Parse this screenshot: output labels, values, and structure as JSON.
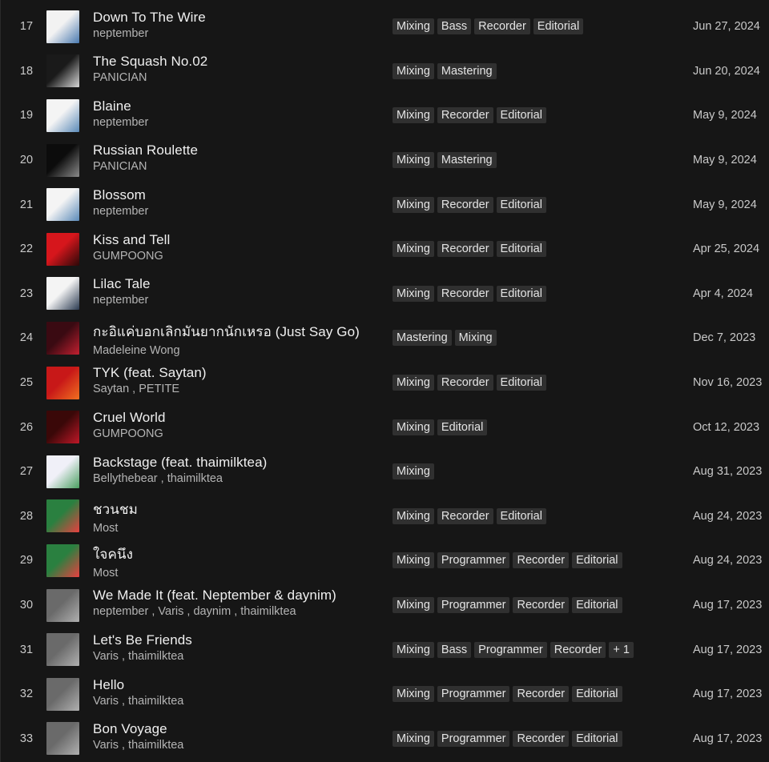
{
  "tracks": [
    {
      "num": "17",
      "title": "Down To The Wire",
      "artist": "neptember",
      "tags": [
        "Mixing",
        "Bass",
        "Recorder",
        "Editorial"
      ],
      "date": "Jun 27, 2024",
      "art_bg": "#f2f2f2",
      "art_fg": "#4a7ab0"
    },
    {
      "num": "18",
      "title": "The Squash No.02",
      "artist": "PANICIAN",
      "tags": [
        "Mixing",
        "Mastering"
      ],
      "date": "Jun 20, 2024",
      "art_bg": "#1a1a1a",
      "art_fg": "#d8d8d8"
    },
    {
      "num": "19",
      "title": "Blaine",
      "artist": "neptember",
      "tags": [
        "Mixing",
        "Recorder",
        "Editorial"
      ],
      "date": "May 9, 2024",
      "art_bg": "#f4f4f4",
      "art_fg": "#5a8ab8"
    },
    {
      "num": "20",
      "title": "Russian Roulette",
      "artist": "PANICIAN",
      "tags": [
        "Mixing",
        "Mastering"
      ],
      "date": "May 9, 2024",
      "art_bg": "#0c0c0c",
      "art_fg": "#8a8a8a"
    },
    {
      "num": "21",
      "title": "Blossom",
      "artist": "neptember",
      "tags": [
        "Mixing",
        "Recorder",
        "Editorial"
      ],
      "date": "May 9, 2024",
      "art_bg": "#f4f4f4",
      "art_fg": "#5a8ab8"
    },
    {
      "num": "22",
      "title": "Kiss and Tell",
      "artist": "GUMPOONG",
      "tags": [
        "Mixing",
        "Recorder",
        "Editorial"
      ],
      "date": "Apr 25, 2024",
      "art_bg": "#d6161c",
      "art_fg": "#2a0808"
    },
    {
      "num": "23",
      "title": "Lilac Tale",
      "artist": "neptember",
      "tags": [
        "Mixing",
        "Recorder",
        "Editorial"
      ],
      "date": "Apr 4, 2024",
      "art_bg": "#f4f4f4",
      "art_fg": "#2a3a50"
    },
    {
      "num": "24",
      "title": "กะอิแค่บอกเลิกมันยากนักเหรอ (Just Say Go)",
      "artist": "Madeleine Wong",
      "tags": [
        "Mastering",
        "Mixing"
      ],
      "date": "Dec 7, 2023",
      "art_bg": "#3a0a12",
      "art_fg": "#c22030"
    },
    {
      "num": "25",
      "title": "TYK (feat. Saytan)",
      "artist": "Saytan , PETITE",
      "tags": [
        "Mixing",
        "Recorder",
        "Editorial"
      ],
      "date": "Nov 16, 2023",
      "art_bg": "#c81818",
      "art_fg": "#f07020"
    },
    {
      "num": "26",
      "title": "Cruel World",
      "artist": "GUMPOONG",
      "tags": [
        "Mixing",
        "Editorial"
      ],
      "date": "Oct 12, 2023",
      "art_bg": "#3a0808",
      "art_fg": "#c01828"
    },
    {
      "num": "27",
      "title": "Backstage (feat. thaimilktea)",
      "artist": "Bellythebear , thaimilktea",
      "tags": [
        "Mixing"
      ],
      "date": "Aug 31, 2023",
      "art_bg": "#f0f0f8",
      "art_fg": "#4aa060"
    },
    {
      "num": "28",
      "title": "ชวนชม",
      "artist": "Most",
      "tags": [
        "Mixing",
        "Recorder",
        "Editorial"
      ],
      "date": "Aug 24, 2023",
      "art_bg": "#2a8040",
      "art_fg": "#e84040"
    },
    {
      "num": "29",
      "title": "ใจคนึง",
      "artist": "Most",
      "tags": [
        "Mixing",
        "Programmer",
        "Recorder",
        "Editorial"
      ],
      "date": "Aug 24, 2023",
      "art_bg": "#2a8040",
      "art_fg": "#e84040"
    },
    {
      "num": "30",
      "title": "We Made It (feat. Neptember & daynim)",
      "artist": "neptember , Varis , daynim , thaimilktea",
      "tags": [
        "Mixing",
        "Programmer",
        "Recorder",
        "Editorial"
      ],
      "date": "Aug 17, 2023",
      "art_bg": "#6a6a6a",
      "art_fg": "#b0b0b0"
    },
    {
      "num": "31",
      "title": "Let's Be Friends",
      "artist": "Varis , thaimilktea",
      "tags": [
        "Mixing",
        "Bass",
        "Programmer",
        "Recorder",
        "+ 1"
      ],
      "date": "Aug 17, 2023",
      "art_bg": "#6a6a6a",
      "art_fg": "#b0b0b0"
    },
    {
      "num": "32",
      "title": "Hello",
      "artist": "Varis , thaimilktea",
      "tags": [
        "Mixing",
        "Programmer",
        "Recorder",
        "Editorial"
      ],
      "date": "Aug 17, 2023",
      "art_bg": "#6a6a6a",
      "art_fg": "#b0b0b0"
    },
    {
      "num": "33",
      "title": "Bon Voyage",
      "artist": "Varis , thaimilktea",
      "tags": [
        "Mixing",
        "Programmer",
        "Recorder",
        "Editorial"
      ],
      "date": "Aug 17, 2023",
      "art_bg": "#6a6a6a",
      "art_fg": "#b0b0b0"
    }
  ]
}
